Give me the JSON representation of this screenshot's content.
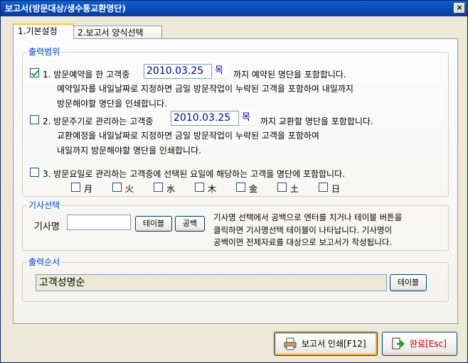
{
  "window": {
    "title": "보고서(방문대상/생수통교환명단)",
    "close": "×"
  },
  "tabs": [
    {
      "label": "1.기본설정",
      "active": true
    },
    {
      "label": "2.보고서 양식선택",
      "active": false
    }
  ],
  "range_group": {
    "legend": "출력범위",
    "opt1": {
      "checked": true,
      "prefix": "1. 방문예약을 한 고객중",
      "date": "2010.03.25",
      "day": "목",
      "suffix": "까지 예약된 명단을 포함합니다.",
      "line2": "예약일자를 내일날짜로 지정하면 금일 방문작업이 누락된 고객을 포함하여 내일까지",
      "line3": "방문해야할 명단을 인쇄합니다."
    },
    "opt2": {
      "checked": false,
      "prefix": "2. 방문주기로 관리하는 고객중",
      "date": "2010.03.25",
      "day": "목",
      "suffix": "까지 교환할 명단을 포함합니다.",
      "line2": "교환예정을 내일날짜로 지정하면 금일 방문작업이 누락된 고객을 포함하여",
      "line3": "내일까지 방문해야할 명단을 인쇄합니다."
    },
    "opt3": {
      "checked": false,
      "text": "3. 방문요일로 관리하는 고객중에  선택된 요일에 해당하는 고객을 명단에 포함합니다."
    },
    "days": [
      "月",
      "火",
      "水",
      "木",
      "金",
      "土",
      "日"
    ]
  },
  "driver_group": {
    "legend": "기사선택",
    "label": "기사명",
    "value": "",
    "table_button": "테이블",
    "blank_button": "공백",
    "help1": "기사명 선택에서 공백으로 엔터를 치거나 테이블 버튼을",
    "help2": "클릭하면 기사명선택 테이블이 나타납니다. 기사명이",
    "help3": "공백이면 전체자료를 대상으로 보고서가 작성됩니다."
  },
  "order_group": {
    "legend": "출력순서",
    "value": "고객성명순",
    "table_button": "테이블"
  },
  "footer": {
    "print_button": "보고서 인쇄[F12]",
    "done_button": "완료[Esc]",
    "done_color": "#c00000"
  }
}
